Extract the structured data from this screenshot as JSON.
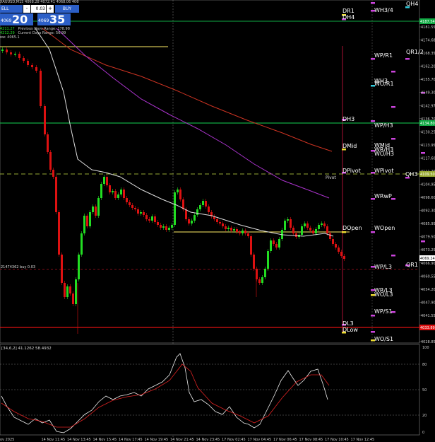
{
  "window": {
    "symbol_header": "XAUUSD,M15 4068.28 4072.41 4068.06 4069.24"
  },
  "trade_panel": {
    "sell_label": "ELL",
    "buy_label": "BUY",
    "minus": "-",
    "plus": "+",
    "lot": "0.03",
    "bid_small": "4069",
    "bid_big": "20",
    "ask_small": "4069",
    "ask_big": "35"
  },
  "info": {
    "line1_left": "4211.27",
    "line1_right": "Previous Days Range: 178.98",
    "line2_left": "4212.29",
    "line2_right": "Current Days Range: 56.99",
    "line3": "ow: 4065.1"
  },
  "price_axis": {
    "ticks": [
      "4181.55",
      "4174.68",
      "4168.35",
      "4162.20",
      "4155.70",
      "4149.30",
      "4142.97",
      "4136.70",
      "4130.25",
      "4123.95",
      "4117.60",
      "4111.25",
      "4104.95",
      "4098.60",
      "4092.30",
      "4085.95",
      "4079.50",
      "4073.25",
      "4066.90",
      "4060.55",
      "4054.20",
      "4047.90",
      "4041.55",
      "4035.20",
      "4028.85"
    ],
    "highlights": [
      {
        "label": "4187.54",
        "color": "#11aa44"
      },
      {
        "label": "4134.80",
        "color": "#11aa44"
      },
      {
        "label": "4109.50",
        "color": "#99aa33"
      },
      {
        "label": "4069.24",
        "color": "#ffffff"
      },
      {
        "label": "4033.89",
        "color": "#dd1111"
      }
    ]
  },
  "levels": [
    {
      "id": "dr1",
      "label": "DR1",
      "color": "#ffffff"
    },
    {
      "id": "dh4",
      "label": "DH4",
      "color": "#ffffff"
    },
    {
      "id": "wh34",
      "label": "WH3/4",
      "color": "#ffffff"
    },
    {
      "id": "qh4",
      "label": "QH4",
      "color": "#ffffff"
    },
    {
      "id": "wpr1",
      "label": "WP/R1",
      "color": "#ffffff"
    },
    {
      "id": "qr12",
      "label": "QR1/2",
      "color": "#ffffff"
    },
    {
      "id": "wh3",
      "label": "WH3",
      "color": "#ffffff"
    },
    {
      "id": "wor1",
      "label": "WO/R1",
      "color": "#ffffff"
    },
    {
      "id": "dh3",
      "label": "DH3",
      "color": "#ffffff"
    },
    {
      "id": "wph3",
      "label": "WP/H3",
      "color": "#ffffff"
    },
    {
      "id": "dmid",
      "label": "DMid",
      "color": "#ffffff"
    },
    {
      "id": "wmid",
      "label": "WMid",
      "color": "#ffffff"
    },
    {
      "id": "wrh3",
      "label": "WR/H3",
      "color": "#ffffff"
    },
    {
      "id": "woh3",
      "label": "WO/H3",
      "color": "#ffffff"
    },
    {
      "id": "dpivot",
      "label": "DPivot",
      "color": "#ffffff"
    },
    {
      "id": "pivot",
      "label": "Pivot",
      "color": "#dddddd"
    },
    {
      "id": "wpivot",
      "label": "WPivot",
      "color": "#ffffff"
    },
    {
      "id": "qh3",
      "label": "QH3",
      "color": "#ffffff"
    },
    {
      "id": "wrwp",
      "label": "WRwP",
      "color": "#ffffff"
    },
    {
      "id": "dopen",
      "label": "DOpen",
      "color": "#ffffff"
    },
    {
      "id": "wopen",
      "label": "WOpen",
      "color": "#ffffff"
    },
    {
      "id": "wpl3",
      "label": "WP/L3",
      "color": "#ffffff"
    },
    {
      "id": "qr1",
      "label": "QR1",
      "color": "#ffffff"
    },
    {
      "id": "wrl3",
      "label": "WR/L3",
      "color": "#ffffff"
    },
    {
      "id": "wol3",
      "label": "WO/L3",
      "color": "#ffffff"
    },
    {
      "id": "wps1",
      "label": "WP/S1",
      "color": "#ffffff"
    },
    {
      "id": "dl3",
      "label": "DL3",
      "color": "#ffffff"
    },
    {
      "id": "dlow",
      "label": "DLow",
      "color": "#ffffff"
    },
    {
      "id": "wos1",
      "label": "WO/S1",
      "color": "#ffffff"
    }
  ],
  "order_line": {
    "label": "21474362 buy 0.03"
  },
  "stoch": {
    "header": "[34,6,2] 41.1262 58.4932",
    "ticks": [
      "100",
      "80",
      "50",
      "20",
      "0"
    ]
  },
  "time_axis": {
    "labels": [
      "ov 2025",
      "14 Nov 11:45",
      "14 Nov 13:45",
      "14 Nov 15:45",
      "14 Nov 17:45",
      "14 Nov 19:45",
      "14 Nov 21:45",
      "14 Nov 23:45",
      "17 Nov 02:45",
      "17 Nov 04:45",
      "17 Nov 06:45",
      "17 Nov 08:45",
      "17 Nov 10:45",
      "17 Nov 12:45"
    ]
  },
  "colors": {
    "bull": "#22dd22",
    "bear": "#dd1111",
    "green_line": "#11aa44",
    "red_line": "#dd1111",
    "yellow_line": "#ffee66",
    "ma_slow": "#cc3322",
    "ma_mid": "#aa33cc",
    "ma_fast": "#dddddd",
    "marker_magenta": "#cc44dd",
    "marker_yellow": "#eedd33",
    "marker_cyan": "#33ccdd"
  }
}
